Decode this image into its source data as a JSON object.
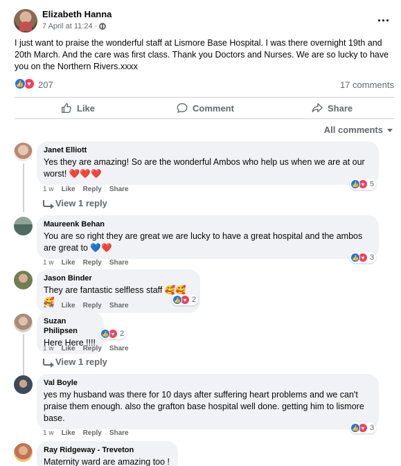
{
  "post": {
    "author": "Elizabeth Hanna",
    "timestamp": "7 April at 11:24 ·",
    "privacy_icon": "globe-icon",
    "text": "I just want to praise the wonderful staff at Lismore Base Hospital. I was there overnight 19th and 20th March. And the care was first class. Thank you Doctors and Nurses. We are so lucky to have you on the Northern Rivers.xxxx",
    "reaction_count": "207",
    "comments_count": "17 comments"
  },
  "actions": {
    "like": "Like",
    "comment": "Comment",
    "share": "Share"
  },
  "comments_filter": "All comments",
  "colors": {
    "like_blue": "#1877f2",
    "love_red": "#f33e58",
    "bubble_bg": "#f0f2f5",
    "meta_gray": "#65676b"
  },
  "comment_actions": {
    "time": "1 w",
    "like": "Like",
    "reply": "Reply",
    "share": "Share"
  },
  "comments": [
    {
      "name": "Janet Elliott",
      "text": "Yes they are amazing! So are the wonderful Ambos who help us when we are at our worst! ❤️❤️❤️",
      "reactions": "5",
      "view_replies": "View 1 reply"
    },
    {
      "name": "Maureenk Behan",
      "text": "You are so right they are great we are lucky to have a great hospital and the ambos are great to 💙❤️",
      "reactions": "3"
    },
    {
      "name": "Jason Binder",
      "text": "They are fantastic selfless staff 🥰🥰🥰",
      "reactions": "2"
    },
    {
      "name": "Suzan Philipsen",
      "text": "Here Here !!!!",
      "reactions": "2",
      "view_replies": "View 1 reply"
    },
    {
      "name": "Val Boyle",
      "text": "yes my husband was there for 10 days after suffering heart problems and we can't praise them enough. also the grafton base hospital well done. getting him to lismore base.",
      "reactions": "3"
    },
    {
      "name": "Ray Ridgeway - Treveton",
      "text": "Maternity ward are amazing too !"
    }
  ]
}
